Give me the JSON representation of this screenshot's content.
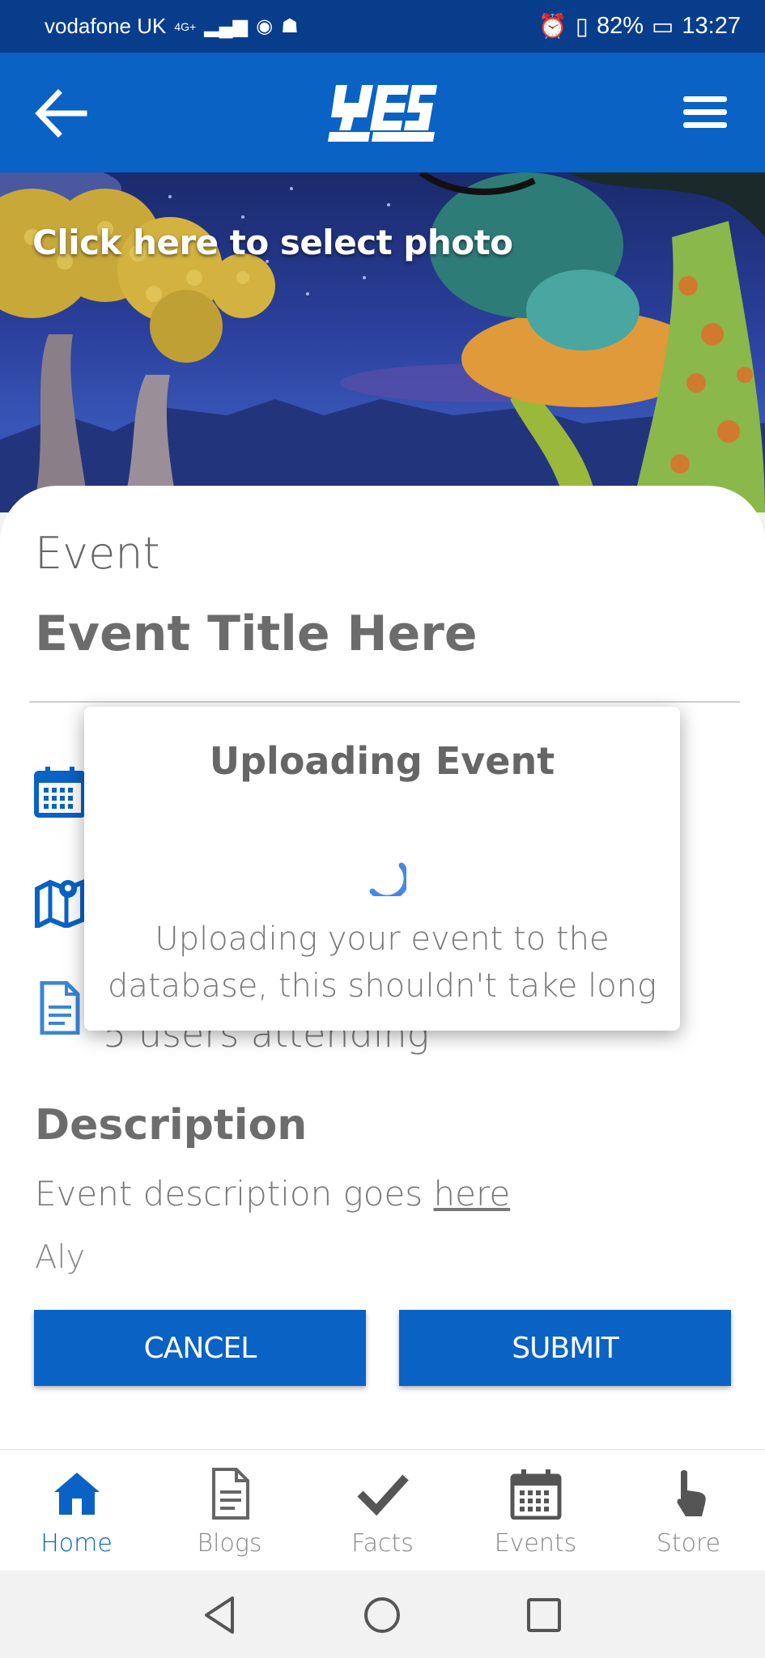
{
  "status_bar": {
    "carrier": "vodafone UK",
    "network": "4G+",
    "battery": "82%",
    "time": "13:27"
  },
  "app_bar": {
    "logo_alt": "YES"
  },
  "hero": {
    "cta": "Click here to select photo"
  },
  "event": {
    "label": "Event",
    "title": "Event Title Here",
    "attending": "5 users attending"
  },
  "description": {
    "heading": "Description",
    "text_prefix": "Event description goes ",
    "text_link": "here",
    "author": "Aly"
  },
  "actions": {
    "cancel": "CANCEL",
    "submit": "SUBMIT"
  },
  "modal": {
    "title": "Uploading Event",
    "message": "Uploading your event to the database, this shouldn't take long"
  },
  "bottom_nav": {
    "items": [
      {
        "label": "Home",
        "icon": "home-icon",
        "active": true
      },
      {
        "label": "Blogs",
        "icon": "document-icon",
        "active": false
      },
      {
        "label": "Facts",
        "icon": "checkmark-icon",
        "active": false
      },
      {
        "label": "Events",
        "icon": "calendar-icon",
        "active": false
      },
      {
        "label": "Store",
        "icon": "pointer-hand-icon",
        "active": false
      }
    ]
  },
  "colors": {
    "primary": "#0a62c4",
    "status_bar": "#083d8c",
    "card": "#ffffff",
    "text_gray": "#666666"
  }
}
